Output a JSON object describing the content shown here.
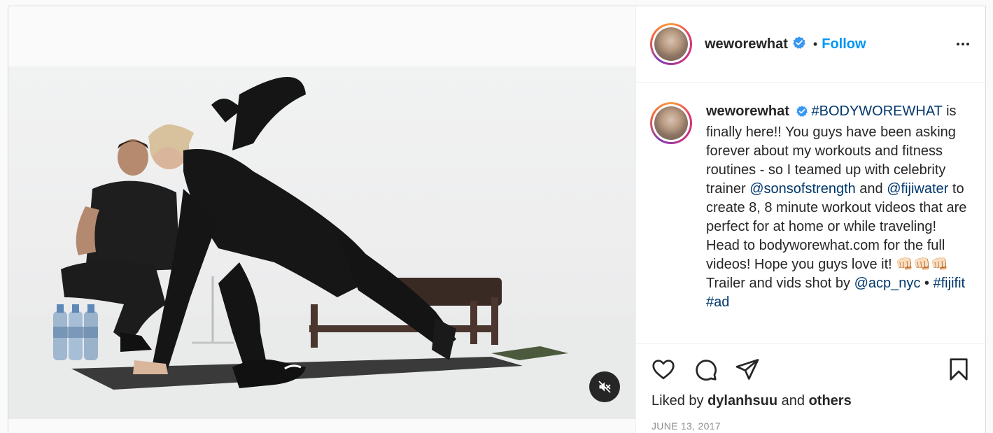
{
  "post": {
    "username": "weworewhat",
    "follow_label": "Follow",
    "separator": "•",
    "caption": {
      "username": "weworewhat",
      "hashtag_main": "#BODYWOREWHAT",
      "text_1": " is finally here!! You guys have been asking forever about my workouts and fitness routines - so I teamed up with celebrity trainer ",
      "mention_1": "@sonsofstrength",
      "text_2": " and ",
      "mention_2": "@fijiwater",
      "text_3": " to create 8, 8 minute workout videos that are perfect for at home or while traveling! Head to bodyworewhat.com for the full videos! Hope you guys love it! ",
      "emoji": "👊🏻👊🏻👊🏻",
      "text_4": "Trailer and vids shot by ",
      "mention_3": "@acp_nyc",
      "text_5": " • ",
      "hashtag_2": "#fijifit",
      "text_6": " ",
      "hashtag_3": "#ad"
    },
    "likes": {
      "prefix": "Liked by ",
      "user": "dylanhsuu",
      "middle": " and ",
      "others": "others"
    },
    "date": "JUNE 13, 2017"
  },
  "icons": {
    "more": "more-options-icon",
    "like": "heart-icon",
    "comment": "comment-icon",
    "share": "share-icon",
    "save": "bookmark-icon",
    "mute": "muted-speaker-icon",
    "verified": "verified-badge-icon"
  },
  "colors": {
    "link": "#00376b",
    "follow": "#0095f6",
    "verified": "#3897f0",
    "muted_text": "#8e8e8e"
  }
}
